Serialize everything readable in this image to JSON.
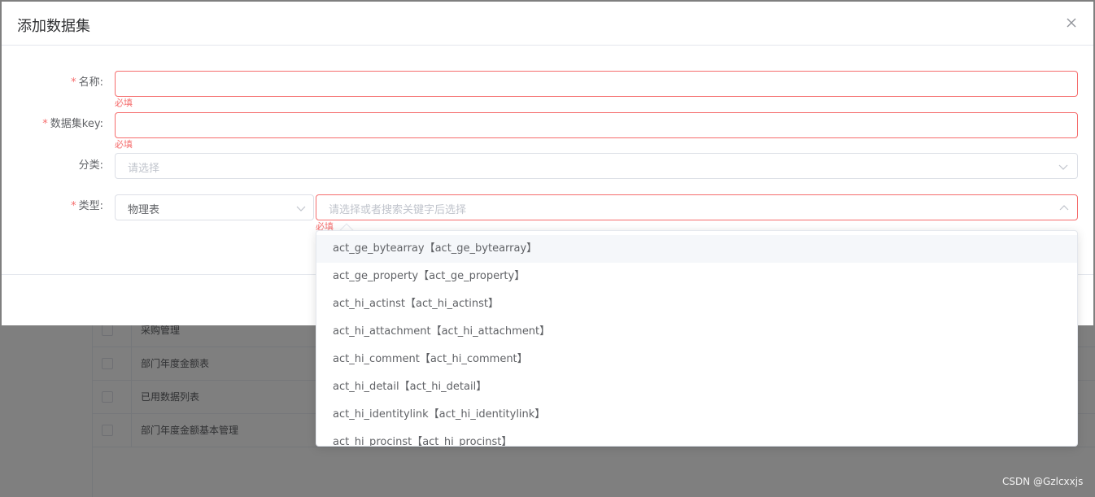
{
  "background_table": {
    "rows": [
      "采购管理",
      "部门年度金额表",
      "已用数据列表",
      "部门年度金额基本管理"
    ]
  },
  "dialog": {
    "title": "添加数据集",
    "close_icon": "close-icon",
    "fields": {
      "name": {
        "required_mark": "*",
        "label": "名称:",
        "value": "",
        "error": "必填"
      },
      "key": {
        "required_mark": "*",
        "label": "数据集key:",
        "value": "",
        "error": "必填"
      },
      "category": {
        "label": "分类:",
        "placeholder": "请选择"
      },
      "type": {
        "required_mark": "*",
        "label": "类型:",
        "type_value": "物理表",
        "table_placeholder": "请选择或者搜索关键字后选择",
        "error": "必填"
      }
    }
  },
  "dropdown": {
    "hovered_index": 0,
    "options": [
      "act_ge_bytearray【act_ge_bytearray】",
      "act_ge_property【act_ge_property】",
      "act_hi_actinst【act_hi_actinst】",
      "act_hi_attachment【act_hi_attachment】",
      "act_hi_comment【act_hi_comment】",
      "act_hi_detail【act_hi_detail】",
      "act_hi_identitylink【act_hi_identitylink】",
      "act_hi_procinst【act_hi_procinst】"
    ]
  },
  "watermark": "CSDN @Gzlcxxjs",
  "colors": {
    "error": "#f56c6c",
    "border": "#dcdfe6",
    "placeholder": "#c0c4cc",
    "hover_bg": "#f5f7fa"
  }
}
